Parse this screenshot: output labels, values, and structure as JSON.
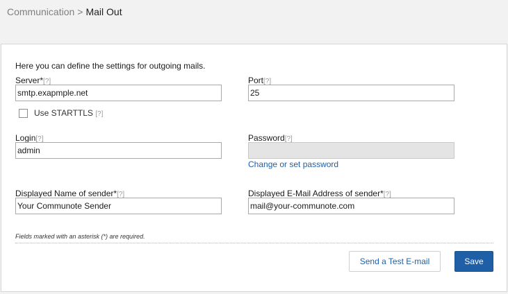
{
  "breadcrumb": {
    "parent": "Communication",
    "separator": ">",
    "current": "Mail Out"
  },
  "form": {
    "intro": "Here you can define the settings for outgoing mails.",
    "hint_marker": "[?]",
    "server": {
      "label": "Server*",
      "value": "smtp.exapmple.net"
    },
    "port": {
      "label": "Port",
      "value": "25"
    },
    "starttls": {
      "label": "Use STARTTLS",
      "checked": false
    },
    "login": {
      "label": "Login",
      "value": "admin"
    },
    "password": {
      "label": "Password",
      "value": "",
      "link": "Change or set password"
    },
    "sender_name": {
      "label": "Displayed Name of sender*",
      "value": "Your Communote Sender"
    },
    "sender_email": {
      "label": "Displayed E-Mail Address of sender*",
      "value": "mail@your-communote.com"
    },
    "required_note": "Fields marked with an asterisk (*) are required."
  },
  "buttons": {
    "test_email": "Send a Test E-mail",
    "save": "Save"
  },
  "colors": {
    "accent": "#1f5fa6",
    "background": "#f2f2f2",
    "panel": "#ffffff",
    "disabled_input": "#e4e4e4"
  }
}
